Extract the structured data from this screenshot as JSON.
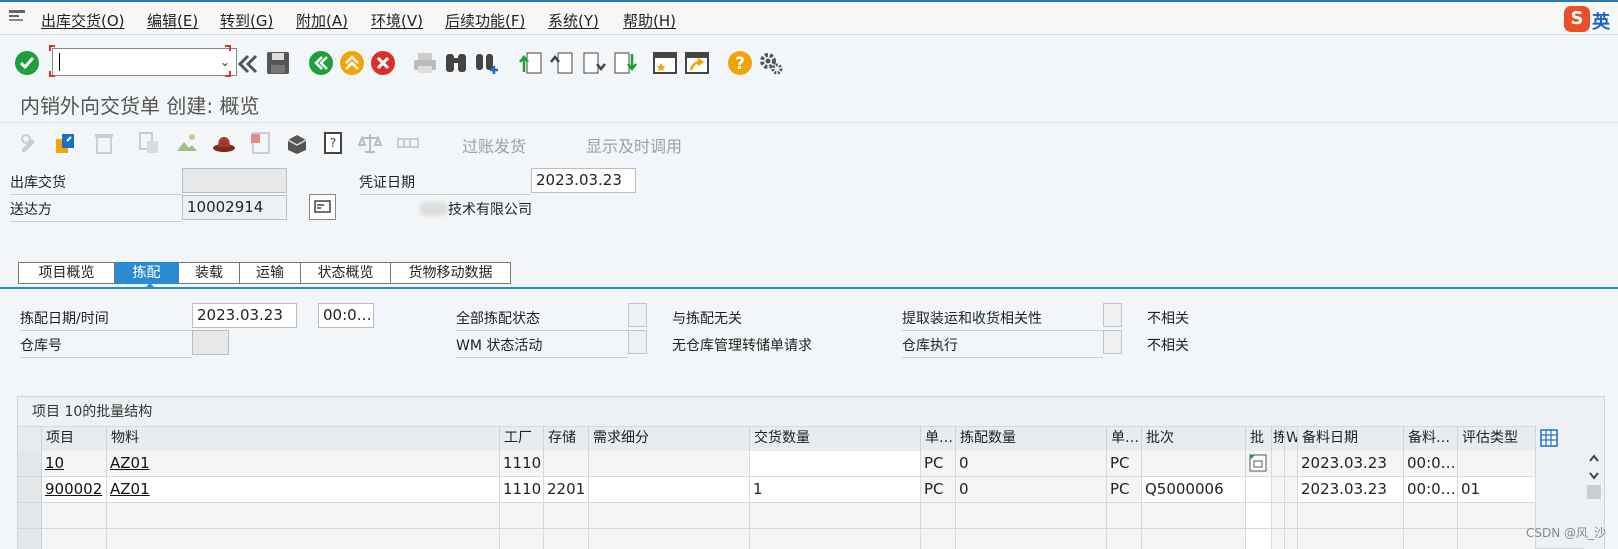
{
  "menu": {
    "items": [
      "出库交货(O)",
      "编辑(E)",
      "转到(G)",
      "附加(A)",
      "环境(V)",
      "后续功能(F)",
      "系统(Y)",
      "帮助(H)"
    ],
    "ime_logo": "S",
    "ime_mode": "英"
  },
  "command_field": {
    "value": ""
  },
  "page_title": "内销外向交货单  创建: 概览",
  "app_toolbar": {
    "post_goods_issue": "过账发货",
    "display_just_in_time": "显示及时调用"
  },
  "header": {
    "outbound_delivery_label": "出库交货",
    "outbound_delivery_value": "",
    "ship_to_label": "送达方",
    "ship_to_value": "10002914",
    "doc_date_label": "凭证日期",
    "doc_date_value": "2023.03.23",
    "ship_to_name": "技术有限公司"
  },
  "tabs": [
    "项目概览",
    "拣配",
    "装载",
    "运输",
    "状态概览",
    "货物移动数据"
  ],
  "active_tab": "拣配",
  "picking": {
    "pick_date_label": "拣配日期/时间",
    "pick_date": "2023.03.23",
    "pick_time": "00:0…",
    "warehouse_label": "仓库号",
    "overall_pick_status_label": "全部拣配状态",
    "overall_pick_status_text": "与拣配无关",
    "wm_activity_label": "WM 状态活动",
    "wm_activity_text": "无仓库管理转储单请求",
    "extraction_label": "提取装运和收货相关性",
    "extraction_text": "不相关",
    "warehouse_exec_label": "仓库执行",
    "warehouse_exec_text": "不相关"
  },
  "table": {
    "title": "项目 10的批量结构",
    "columns": [
      "项目",
      "物料",
      "工厂",
      "存储",
      "需求细分",
      "交货数量",
      "单…",
      "拣配数量",
      "单…",
      "批次",
      "批",
      "拣",
      "W",
      "备料日期",
      "备料…",
      "评估类型"
    ],
    "rows": [
      [
        "10",
        "AZ01",
        "1110",
        "",
        "",
        "",
        "PC",
        "0",
        "PC",
        "",
        "",
        "",
        "",
        "2023.03.23",
        "00:0…",
        ""
      ],
      [
        "900002",
        "AZ01",
        "1110",
        "2201",
        "",
        "1",
        "PC",
        "0",
        "PC",
        "Q5000006",
        "",
        "",
        "",
        "2023.03.23",
        "00:0…",
        "01"
      ]
    ]
  },
  "watermark": "CSDN @风_沙",
  "colors": {
    "accent": "#2a8bd2",
    "ok_green": "#1e9e3c",
    "cancel_red": "#d9302c",
    "help_orange": "#f2a50b"
  }
}
